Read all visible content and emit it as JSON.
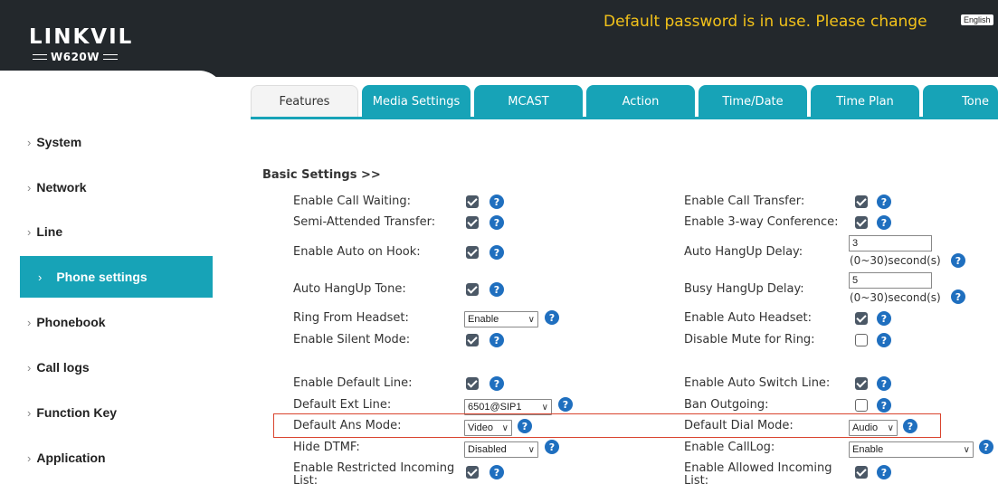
{
  "header": {
    "logo_main": "LINKVIL",
    "logo_model": "W620W",
    "password_warning": "Default password is in use. Please change",
    "language_button": "English"
  },
  "sidebar": {
    "items": [
      {
        "label": "System"
      },
      {
        "label": "Network"
      },
      {
        "label": "Line"
      },
      {
        "label": "Phone settings"
      },
      {
        "label": "Phonebook"
      },
      {
        "label": "Call logs"
      },
      {
        "label": "Function Key"
      },
      {
        "label": "Application"
      }
    ],
    "active_index": 3
  },
  "tabs": [
    {
      "label": "Features"
    },
    {
      "label": "Media Settings"
    },
    {
      "label": "MCAST"
    },
    {
      "label": "Action"
    },
    {
      "label": "Time/Date"
    },
    {
      "label": "Time Plan"
    },
    {
      "label": "Tone"
    }
  ],
  "section": {
    "title": "Basic Settings >>"
  },
  "settings": {
    "call_waiting": {
      "label": "Enable Call Waiting:",
      "checked": true
    },
    "call_transfer": {
      "label": "Enable Call Transfer:",
      "checked": true
    },
    "semi_attended": {
      "label": "Semi-Attended Transfer:",
      "checked": true
    },
    "three_way": {
      "label": "Enable 3-way Conference:",
      "checked": true
    },
    "auto_on_hook": {
      "label": "Enable Auto on Hook:",
      "checked": true
    },
    "auto_hangup_delay": {
      "label": "Auto HangUp Delay:",
      "value": "3",
      "unit": "(0~30)second(s)"
    },
    "auto_hangup_tone": {
      "label": "Auto HangUp Tone:",
      "checked": true
    },
    "busy_hangup_delay": {
      "label": "Busy HangUp Delay:",
      "value": "5",
      "unit": "(0~30)second(s)"
    },
    "ring_from_headset": {
      "label": "Ring From Headset:",
      "value": "Enable"
    },
    "auto_headset": {
      "label": "Enable Auto Headset:",
      "checked": true
    },
    "silent_mode": {
      "label": "Enable Silent Mode:",
      "checked": true
    },
    "disable_mute_ring": {
      "label": "Disable Mute for Ring:",
      "checked": false
    },
    "default_line": {
      "label": "Enable Default Line:",
      "checked": true
    },
    "auto_switch_line": {
      "label": "Enable Auto Switch Line:",
      "checked": true
    },
    "default_ext_line": {
      "label": "Default Ext Line:",
      "value": "6501@SIP1"
    },
    "ban_outgoing": {
      "label": "Ban Outgoing:",
      "checked": false
    },
    "default_ans_mode": {
      "label": "Default Ans Mode:",
      "value": "Video"
    },
    "default_dial_mode": {
      "label": "Default Dial Mode:",
      "value": "Audio"
    },
    "hide_dtmf": {
      "label": "Hide DTMF:",
      "value": "Disabled"
    },
    "call_log": {
      "label": "Enable CallLog:",
      "value": "Enable"
    },
    "restricted_incoming": {
      "label": "Enable Restricted Incoming List:",
      "checked": true
    },
    "allowed_incoming": {
      "label": "Enable Allowed Incoming List:",
      "checked": true
    }
  },
  "help_glyph": "?",
  "colors": {
    "header_bg": "#23282c",
    "accent": "#17a3b7",
    "warning": "#f2c21a",
    "highlight": "#d9442e",
    "help_icon": "#1f6fbf",
    "checkbox": "#4b5866"
  }
}
